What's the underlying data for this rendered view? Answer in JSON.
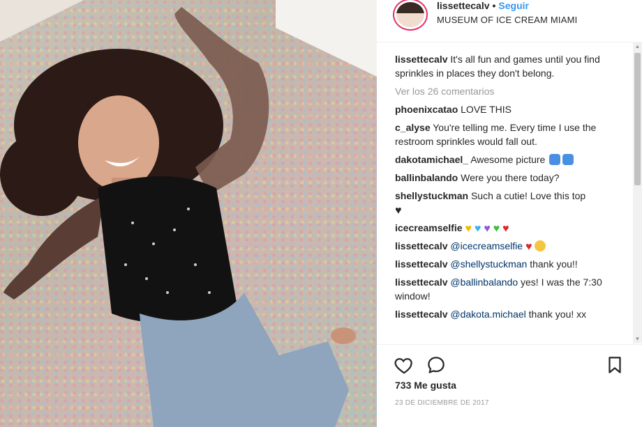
{
  "post": {
    "username": "lissettecalv",
    "follow_label": "Seguir",
    "location": "MUSEUM OF ICE CREAM MIAMI",
    "view_comments_label": "Ver los 26 comentarios",
    "likes": "733 Me gusta",
    "date": "23 DE DICIEMBRE DE 2017"
  },
  "comments": [
    {
      "user": "lissettecalv",
      "text": "It's all fun and games until you find sprinkles in places they don't belong."
    },
    {
      "user": "phoenixcatao",
      "text": "LOVE THIS"
    },
    {
      "user": "c_alyse",
      "text": "You're telling me. Every time I use the restroom sprinkles would fall out."
    },
    {
      "user": "dakotamichael_",
      "text": "Awesome picture"
    },
    {
      "user": "ballinbalando",
      "text": "Were you there today?"
    },
    {
      "user": "shellystuckman",
      "text": "Such a cutie! Love this top"
    },
    {
      "user": "icecreamselfie",
      "text": ""
    },
    {
      "user": "lissettecalv",
      "mention": "@icecreamselfie",
      "text": ""
    },
    {
      "user": "lissettecalv",
      "mention": "@shellystuckman",
      "text": "thank you!!"
    },
    {
      "user": "lissettecalv",
      "mention": "@ballinbalando",
      "text": "yes! I was the 7:30 window!"
    },
    {
      "user": "lissettecalv",
      "mention": "@dakota.michael",
      "text": "thank you! xx"
    }
  ],
  "icons": {
    "like": "heart-outline-icon",
    "comment": "comment-bubble-icon",
    "save": "bookmark-icon"
  },
  "colors": {
    "follow": "#3897f0",
    "mention": "#003569",
    "muted": "#999999"
  }
}
